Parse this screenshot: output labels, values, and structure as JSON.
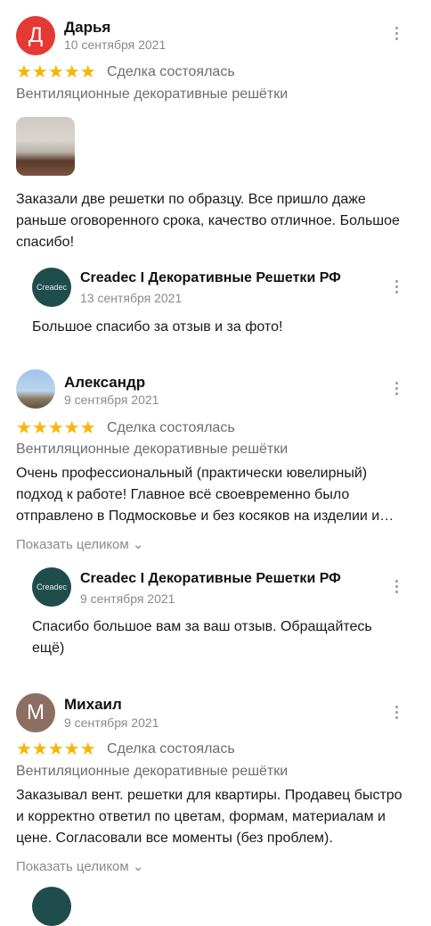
{
  "reviews": [
    {
      "author": "Дарья",
      "avatar_letter": "Д",
      "avatar_color": "#e53935",
      "date": "10 сентября 2021",
      "stars": "★★★★★",
      "deal_status": "Сделка состоялась",
      "category": "Вентиляционные декоративные решётки",
      "text": "Заказали две решетки по образцу. Все пришло даже раньше оговоренного срока, качество отличное. Большое спасибо!",
      "reply": {
        "author": "Creadec I Декоративные Решетки РФ",
        "avatar_text": "Creadec",
        "date": "13 сентября 2021",
        "text": "Большое спасибо за отзыв и за фото!"
      }
    },
    {
      "author": "Александр",
      "date": "9 сентября 2021",
      "stars": "★★★★★",
      "deal_status": "Сделка состоялась",
      "category": "Вентиляционные декоративные решётки",
      "text": "Очень профессиональный (практически ювелирный) подход к работе! Главное всё своевременно было отправлено в Подмосковье и без косяков на изделии и упаковке.",
      "show_more": "Показать целиком ⌄",
      "reply": {
        "author": "Creadec I Декоративные Решетки РФ",
        "avatar_text": "Creadec",
        "date": "9 сентября 2021",
        "text": "Спасибо большое вам за ваш отзыв. Обращайтесь ещё)"
      }
    },
    {
      "author": "Михаил",
      "avatar_letter": "М",
      "avatar_color": "#8d6e63",
      "date": "9 сентября 2021",
      "stars": "★★★★★",
      "deal_status": "Сделка состоялась",
      "category": "Вентиляционные декоративные решётки",
      "text": "Заказывал вент. решетки для квартиры. Продавец быстро и корректно ответил по цветам, формам, материалам и цене. Согласовали все моменты (без проблем).",
      "show_more": "Показать целиком ⌄"
    }
  ]
}
